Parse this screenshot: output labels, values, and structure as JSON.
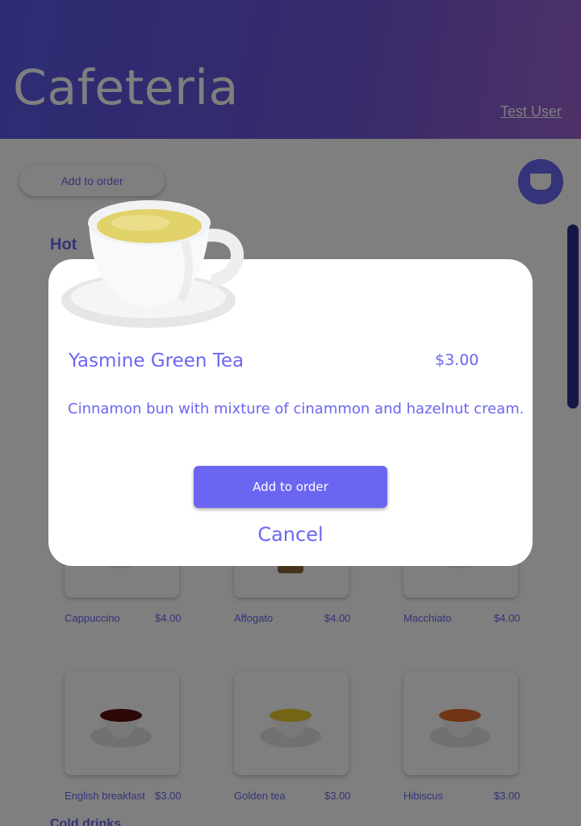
{
  "header": {
    "title": "Cafeteria",
    "link_label": "Test User"
  },
  "toolbar": {
    "add_order_label": "Add to order",
    "cart_icon": "cup-icon"
  },
  "menu": {
    "section_title": "Hot",
    "section_title_2": "Cold drinks",
    "items": [
      {
        "name": "Cappuccino",
        "price": "$4.00"
      },
      {
        "name": "Affogato",
        "price": "$4.00"
      },
      {
        "name": "Macchiato",
        "price": "$4.00"
      },
      {
        "name": "English breakfast",
        "price": "$3.00"
      },
      {
        "name": "Golden tea",
        "price": "$3.00"
      },
      {
        "name": "Hibiscus",
        "price": "$3.00"
      }
    ]
  },
  "modal": {
    "item_name": "Yasmine Green Tea",
    "price": "$3.00",
    "description": "Cinnamon bun with mixture of cinammon and hazelnut cream.",
    "add_button_label": "Add to order",
    "cancel_label": "Cancel"
  },
  "colors": {
    "accent": "#6b66f2",
    "header_start": "#5a58e6",
    "header_end": "#9b63cf",
    "overlay": "rgba(0,0,0,0.5)"
  }
}
